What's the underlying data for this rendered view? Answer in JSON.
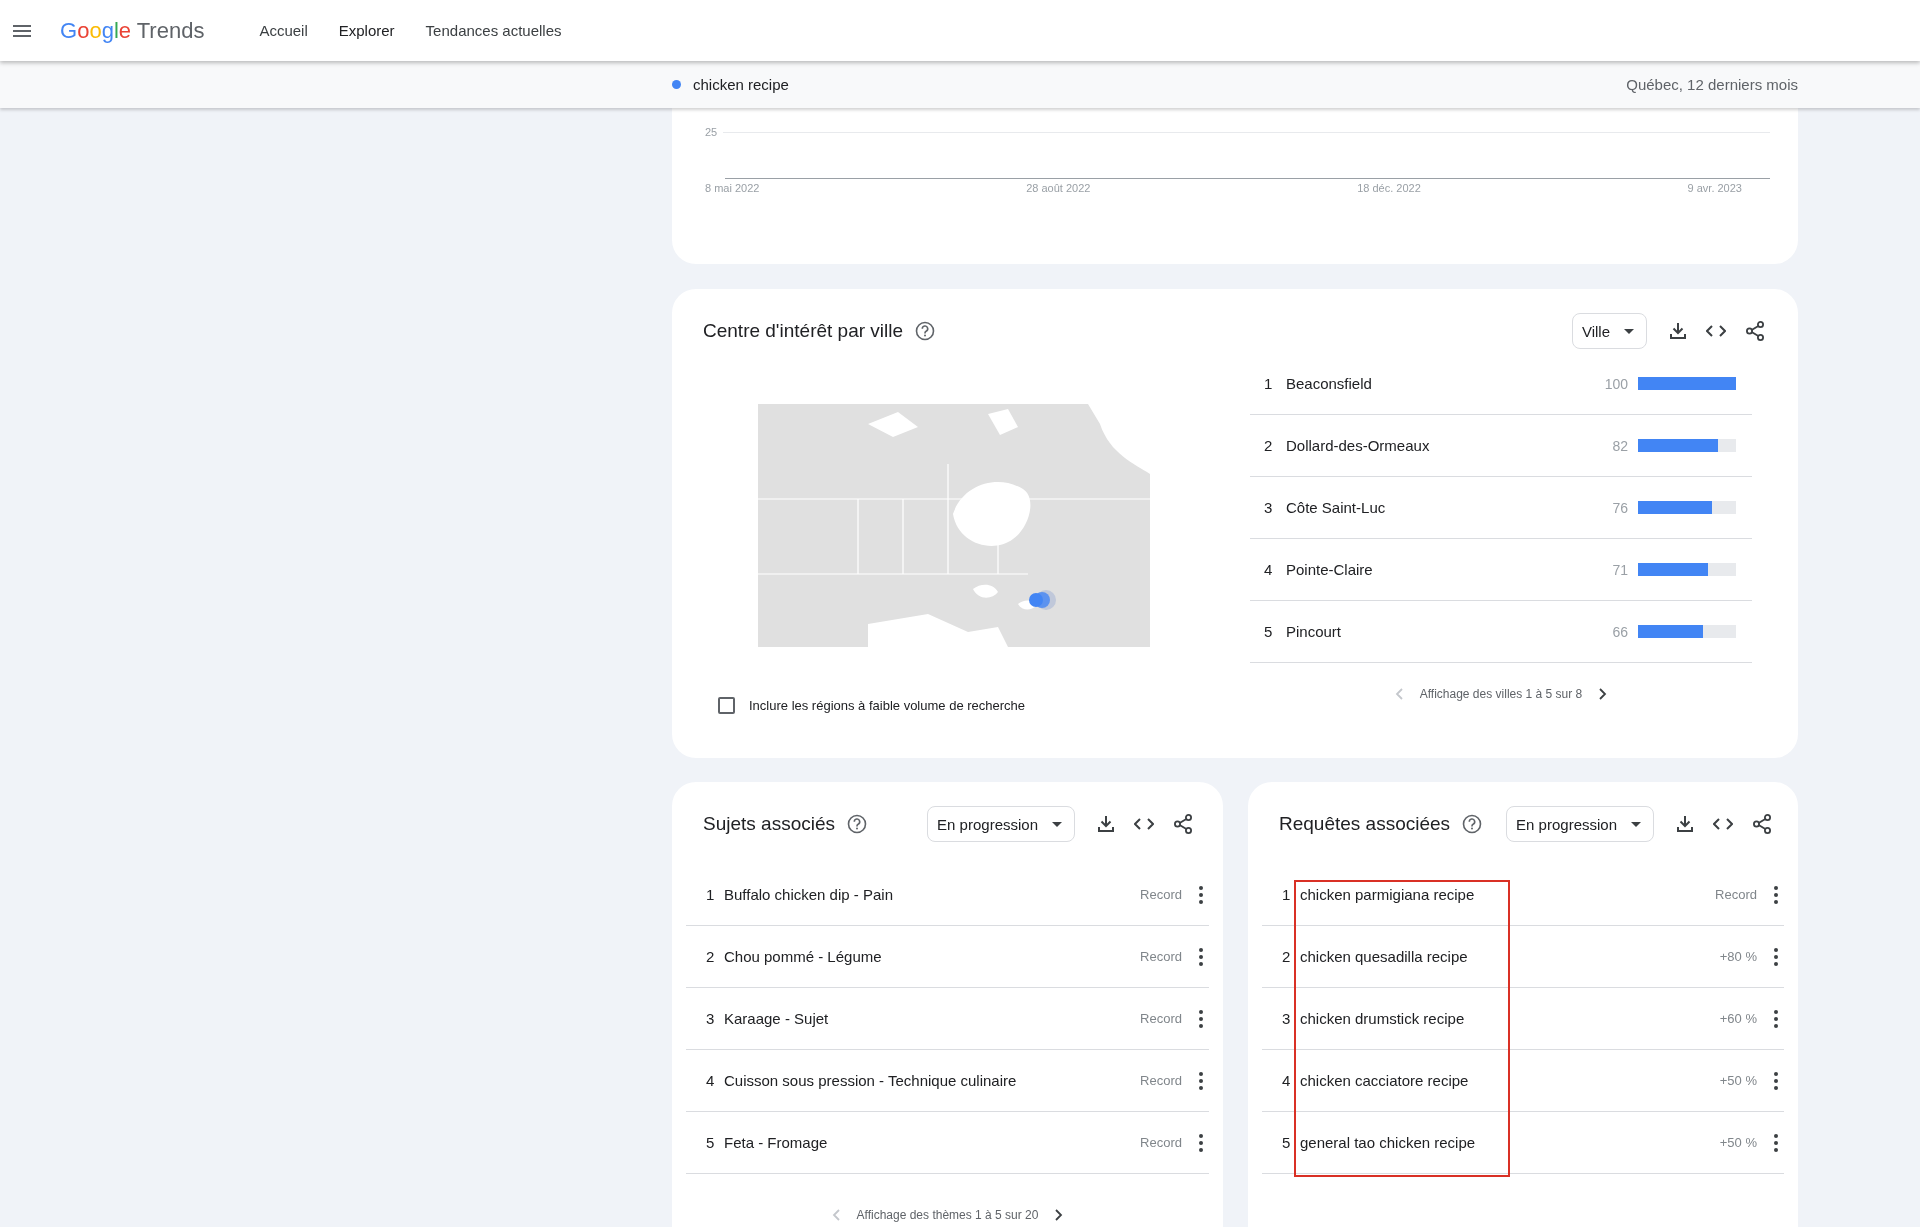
{
  "header": {
    "logo": {
      "brand": "Google",
      "product": "Trends"
    },
    "nav": [
      {
        "label": "Accueil",
        "selected": false
      },
      {
        "label": "Explorer",
        "selected": true
      },
      {
        "label": "Tendances actuelles",
        "selected": false
      }
    ]
  },
  "comparison_bar": {
    "term": "chicken recipe",
    "scope": "Québec, 12 derniers mois"
  },
  "interest_over_time": {
    "y_tick": "25",
    "x_labels": [
      "8 mai 2022",
      "28 août 2022",
      "18 déc. 2022",
      "9 avr. 2023"
    ]
  },
  "interest_by_city": {
    "title": "Centre d'intérêt par ville",
    "resolution": "Ville",
    "cities": [
      {
        "rank": "1",
        "name": "Beaconsfield",
        "value": "100",
        "level": 1.0
      },
      {
        "rank": "2",
        "name": "Dollard-des-Ormeaux",
        "value": "82",
        "level": 0.82
      },
      {
        "rank": "3",
        "name": "Côte Saint-Luc",
        "value": "76",
        "level": 0.76
      },
      {
        "rank": "4",
        "name": "Pointe-Claire",
        "value": "71",
        "level": 0.71
      },
      {
        "rank": "5",
        "name": "Pincourt",
        "value": "66",
        "level": 0.66
      }
    ],
    "pagination": {
      "text": "Affichage des villes 1 à 5 sur 8",
      "prev_disabled": true
    },
    "low_volume_checkbox": {
      "label": "Inclure les régions à faible volume de recherche",
      "checked": false
    }
  },
  "related_topics": {
    "title": "Sujets associés",
    "filter": "En progression",
    "items": [
      {
        "rank": "1",
        "label": "Buffalo chicken dip - Pain",
        "value": "Record"
      },
      {
        "rank": "2",
        "label": "Chou pommé - Légume",
        "value": "Record"
      },
      {
        "rank": "3",
        "label": "Karaage - Sujet",
        "value": "Record"
      },
      {
        "rank": "4",
        "label": "Cuisson sous pression - Technique culinaire",
        "value": "Record"
      },
      {
        "rank": "5",
        "label": "Feta - Fromage",
        "value": "Record"
      }
    ],
    "pagination": {
      "text": "Affichage des thèmes 1 à 5 sur 20",
      "prev_disabled": true
    }
  },
  "related_queries": {
    "title": "Requêtes associées",
    "filter": "En progression",
    "annotation_box": true,
    "items": [
      {
        "rank": "1",
        "label": "chicken parmigiana recipe",
        "value": "Record"
      },
      {
        "rank": "2",
        "label": "chicken quesadilla recipe",
        "value": "+80 %"
      },
      {
        "rank": "3",
        "label": "chicken drumstick recipe",
        "value": "+60 %"
      },
      {
        "rank": "4",
        "label": "chicken cacciatore recipe",
        "value": "+50 %"
      },
      {
        "rank": "5",
        "label": "general tao chicken recipe",
        "value": "+50 %"
      }
    ]
  }
}
